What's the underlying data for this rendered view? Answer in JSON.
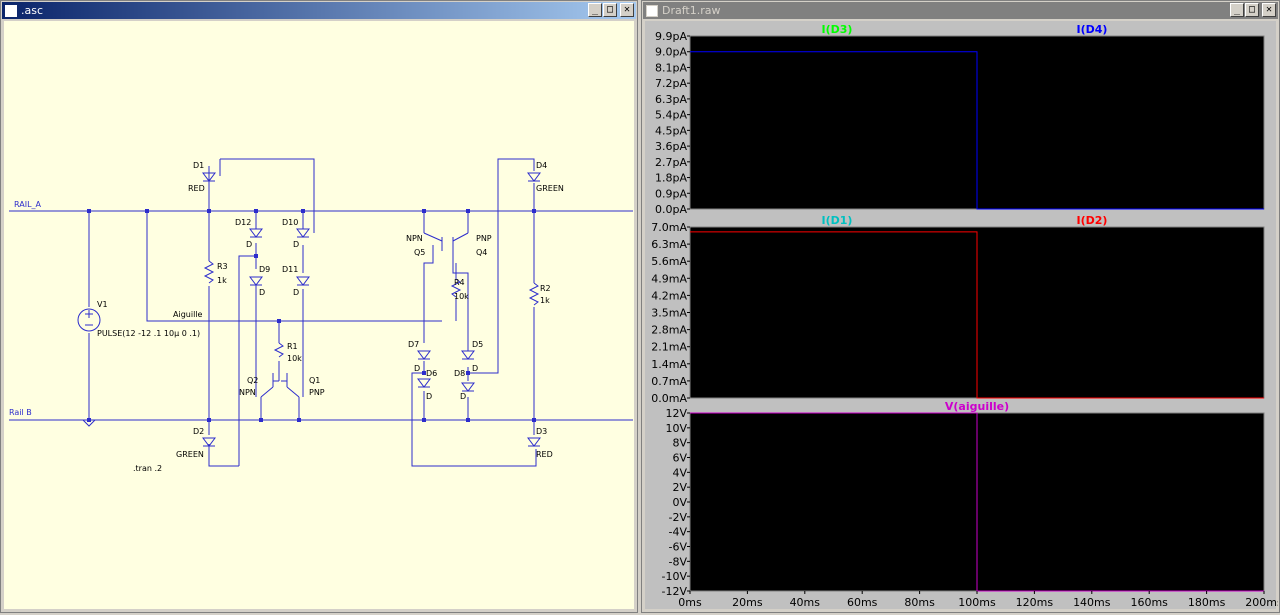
{
  "schematic": {
    "title": ".asc"
  },
  "waveform": {
    "title": "Draft1.raw"
  },
  "window_buttons": {
    "min": "_",
    "max": "□",
    "close": "✕"
  },
  "nets": {
    "rail_a": "RAIL_A",
    "rail_b": "Rail B",
    "aiguille": "Aiguille"
  },
  "parts": {
    "d1": "D1",
    "d1v": "RED",
    "d2": "D2",
    "d2v": "GREEN",
    "d3": "D3",
    "d3v": "RED",
    "d4": "D4",
    "d4v": "GREEN",
    "d5": "D5",
    "d6": "D6",
    "d7": "D7",
    "d8": "D8",
    "d9": "D9",
    "d10": "D10",
    "d11": "D11",
    "d12": "D12",
    "dv": "D",
    "r1": "R1",
    "r1v": "10k",
    "r2": "R2",
    "r2v": "1k",
    "r3": "R3",
    "r3v": "1k",
    "r4": "R4",
    "r4v": "10k",
    "q1": "Q1",
    "q1v": "PNP",
    "q2": "Q2",
    "q2v": "NPN",
    "q4": "Q4",
    "q4v": "PNP",
    "q5": "Q5",
    "q5v": "NPN",
    "v1": "V1",
    "v1v": "PULSE(12 -12 .1 10µ 0 .1)",
    "tran": ".tran .2"
  },
  "xaxis": {
    "ticks": [
      "0ms",
      "20ms",
      "40ms",
      "60ms",
      "80ms",
      "100ms",
      "120ms",
      "140ms",
      "160ms",
      "180ms",
      "200ms"
    ]
  },
  "colors": {
    "wire": "#2d2dcc",
    "bg_sch": "#ffffe1",
    "trace_d3": "#00ff00",
    "trace_d4": "#0000ff",
    "trace_d1": "#00c0c0",
    "trace_d2": "#ff0000",
    "trace_aig": "#cc00cc",
    "plot_bg": "#000000",
    "grid": "#808080"
  },
  "chart_data": [
    {
      "type": "line",
      "series": [
        {
          "name": "I(D3)"
        },
        {
          "name": "I(D4)",
          "x": [
            0,
            100,
            100,
            200
          ],
          "y": [
            9.0,
            9.0,
            0,
            0
          ]
        }
      ],
      "yticks": [
        "9.9pA",
        "9.0pA",
        "8.1pA",
        "7.2pA",
        "6.3pA",
        "5.4pA",
        "4.5pA",
        "3.6pA",
        "2.7pA",
        "1.8pA",
        "0.9pA",
        "0.0pA"
      ],
      "ylim": [
        0,
        9.9
      ],
      "xlim": [
        0,
        200
      ]
    },
    {
      "type": "line",
      "series": [
        {
          "name": "I(D1)"
        },
        {
          "name": "I(D2)",
          "x": [
            0,
            100,
            100,
            200
          ],
          "y": [
            6.8,
            6.8,
            0,
            0
          ]
        }
      ],
      "yticks": [
        "7.0mA",
        "6.3mA",
        "5.6mA",
        "4.9mA",
        "4.2mA",
        "3.5mA",
        "2.8mA",
        "2.1mA",
        "1.4mA",
        "0.7mA",
        "0.0mA"
      ],
      "ylim": [
        0,
        7.0
      ],
      "xlim": [
        0,
        200
      ]
    },
    {
      "type": "line",
      "series": [
        {
          "name": "V(aiguille)",
          "x": [
            0,
            100,
            100,
            200
          ],
          "y": [
            12,
            12,
            -12,
            -12
          ]
        }
      ],
      "yticks": [
        "12V",
        "10V",
        "8V",
        "6V",
        "4V",
        "2V",
        "0V",
        "-2V",
        "-4V",
        "-6V",
        "-8V",
        "-10V",
        "-12V"
      ],
      "ylim": [
        -12,
        12
      ],
      "xlim": [
        0,
        200
      ]
    }
  ]
}
